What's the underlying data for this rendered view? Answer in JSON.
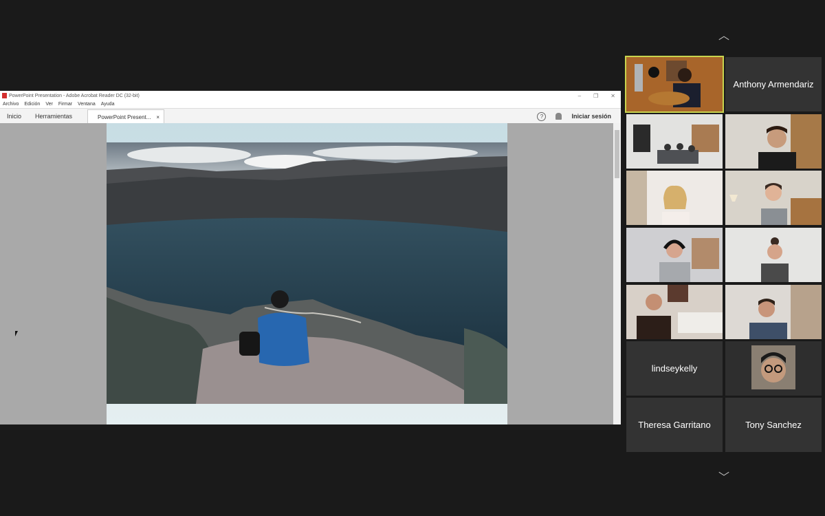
{
  "window": {
    "title": "PowerPoint Presentation - Adobe Acrobat Reader DC (32-bit)",
    "controls": [
      "–",
      "❐",
      "✕"
    ]
  },
  "menu": [
    "Archivo",
    "Edición",
    "Ver",
    "Firmar",
    "Ventana",
    "Ayuda"
  ],
  "toolbar": {
    "home": "Inicio",
    "tools": "Herramientas",
    "doc_tab": "PowerPoint Present...",
    "doc_tab_close": "×",
    "help": "?",
    "signin": "Iniciar sesión"
  },
  "gallery": {
    "nav_up": "︿",
    "nav_down": "﹀",
    "tiles": [
      {
        "type": "video",
        "name": "anthony-video"
      },
      {
        "type": "name",
        "label": "Anthony Armendariz"
      },
      {
        "type": "video",
        "name": "group-room-video"
      },
      {
        "type": "video",
        "name": "bearded-man-video"
      },
      {
        "type": "video",
        "name": "blonde-woman-video"
      },
      {
        "type": "video",
        "name": "woman-lamp-video"
      },
      {
        "type": "video",
        "name": "woman-headphones-video"
      },
      {
        "type": "video",
        "name": "woman-bun-video"
      },
      {
        "type": "video",
        "name": "man-bed-video"
      },
      {
        "type": "video",
        "name": "man-thinking-video"
      },
      {
        "type": "name",
        "label": "lindseykelly"
      },
      {
        "type": "avatar",
        "name": "glasses-man-avatar"
      },
      {
        "type": "name",
        "label": "Theresa Garritano"
      },
      {
        "type": "name",
        "label": "Tony Sanchez"
      }
    ]
  }
}
